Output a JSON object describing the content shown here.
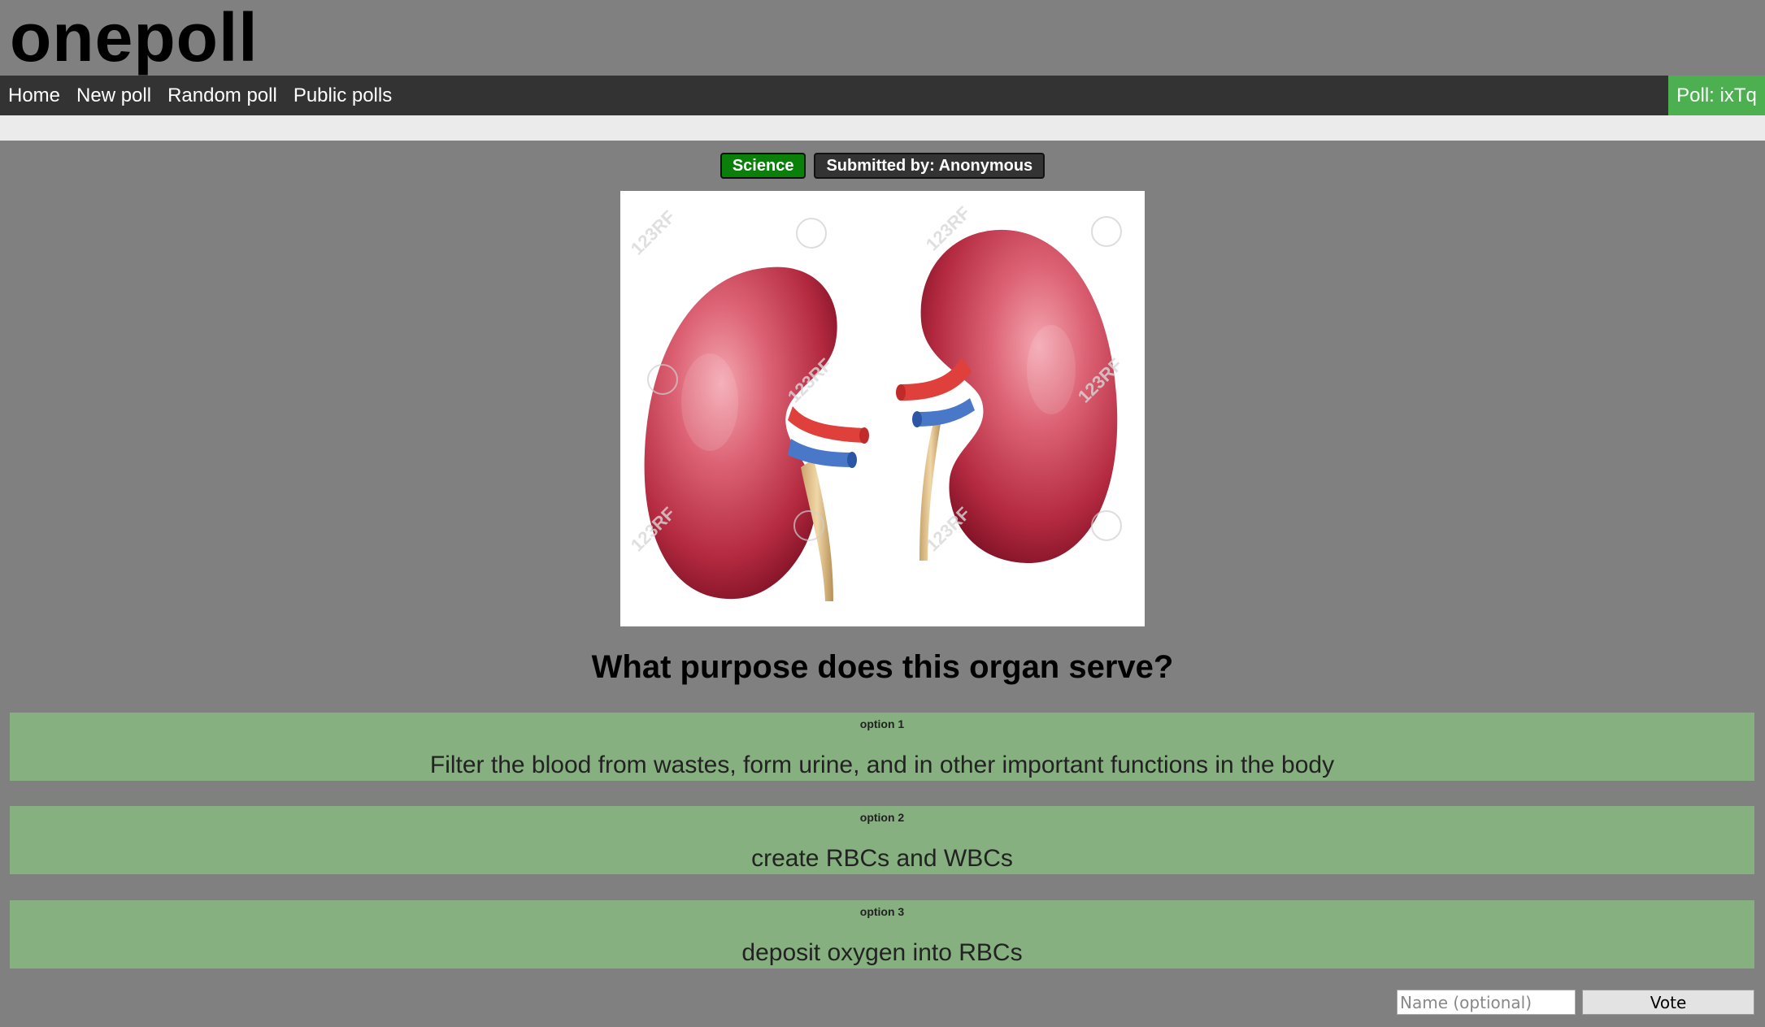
{
  "site": {
    "title": "onepoll"
  },
  "nav": {
    "items": [
      {
        "label": "Home"
      },
      {
        "label": "New poll"
      },
      {
        "label": "Random poll"
      },
      {
        "label": "Public polls"
      }
    ],
    "poll_id_label": "Poll: ixTq"
  },
  "poll": {
    "category": "Science",
    "submitted_by": "Submitted by: Anonymous",
    "image": {
      "icon": "kidneys-illustration",
      "watermark": "123RF"
    },
    "question": "What purpose does this organ serve?",
    "options": [
      {
        "number": "option 1",
        "text": "Filter the blood from wastes, form urine, and in other important functions in the body"
      },
      {
        "number": "option 2",
        "text": "create RBCs and WBCs"
      },
      {
        "number": "option 3",
        "text": "deposit oxygen into RBCs"
      }
    ]
  },
  "vote_form": {
    "name_placeholder": "Name (optional)",
    "vote_label": "Vote"
  },
  "colors": {
    "background": "#808080",
    "navbar": "#333333",
    "poll_id_badge": "#4caf50",
    "category_tag": "#0a7f0a",
    "option_bg": "#86b07f"
  }
}
